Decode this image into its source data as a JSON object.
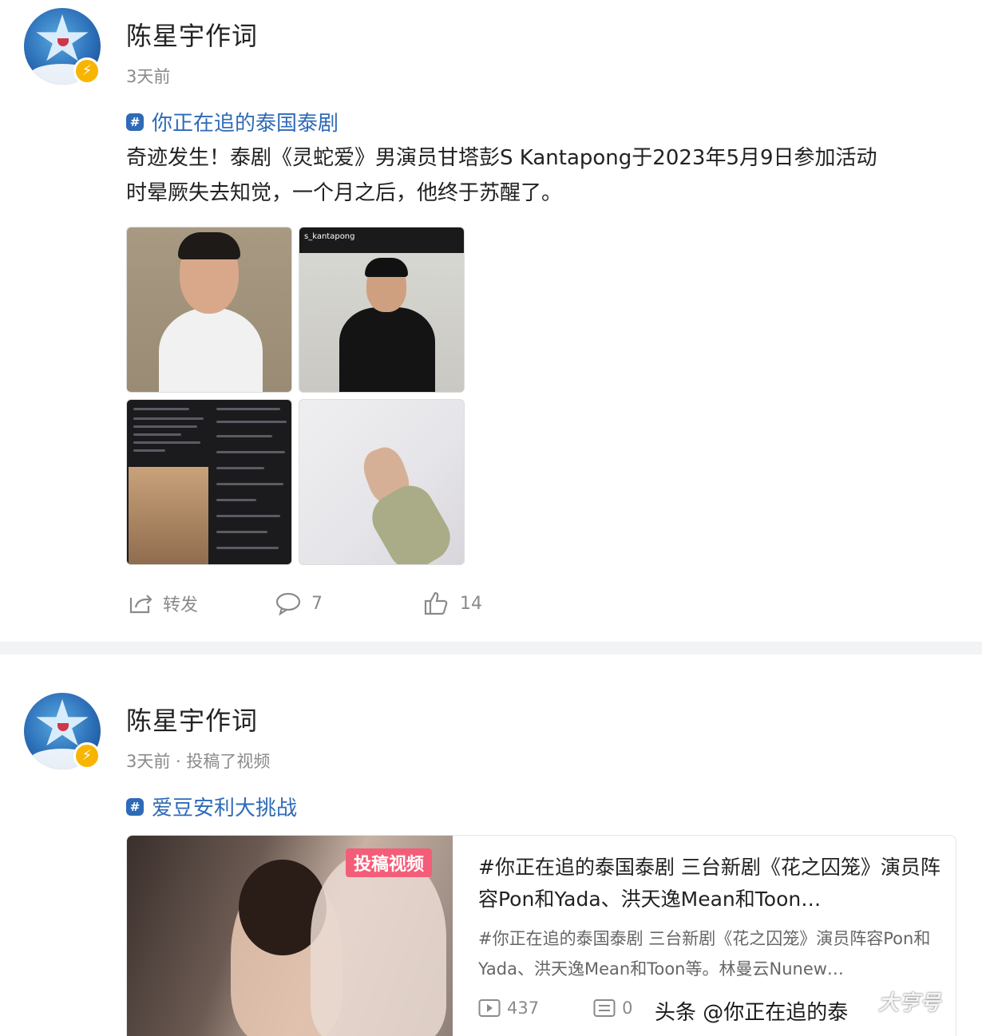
{
  "posts": [
    {
      "username": "陈星宇作词",
      "meta": "3天前",
      "topic": "你正在追的泰国泰剧",
      "text_line1": "奇迹发生！泰剧《灵蛇爱》男演员甘塔彭S  Kantapong于2023年5月9日参加活动",
      "text_line2": "时晕厥失去知觉，一个月之后，他终于苏醒了。",
      "images": [
        {
          "alt": "portrait-white-shirt"
        },
        {
          "alt": "portrait-black-suit",
          "handle": "s_kantapong"
        },
        {
          "alt": "social-post-screenshot"
        },
        {
          "alt": "hospital-hand"
        }
      ],
      "actions": {
        "share_label": "转发",
        "comment_count": "7",
        "like_count": "14"
      }
    },
    {
      "username": "陈星宇作词",
      "meta": "3天前 · 投稿了视频",
      "topic": "爱豆安利大挑战",
      "video": {
        "badge": "投稿视频",
        "title": "#你正在追的泰国泰剧 三台新剧《花之囚笼》演员阵容Pon和Yada、洪天逸Mean和Toon…",
        "description": "#你正在追的泰国泰剧 三台新剧《花之囚笼》演员阵容Pon和Yada、洪天逸Mean和Toon等。林曼云Nunew…",
        "plays": "437",
        "danmaku": "0"
      }
    }
  ],
  "watermark": "头条 @你正在追的泰",
  "icons": {
    "share": "share-icon",
    "comment": "comment-icon",
    "like": "thumbs-up-icon",
    "topic": "topic-hash-icon",
    "verified": "verified-badge-icon",
    "play": "play-icon",
    "danmaku": "danmaku-icon"
  },
  "colors": {
    "topic_link": "#2e6ab7",
    "verified_badge": "#f7b500",
    "video_badge": "#f45d78",
    "meta_text": "#8a8a8a"
  }
}
